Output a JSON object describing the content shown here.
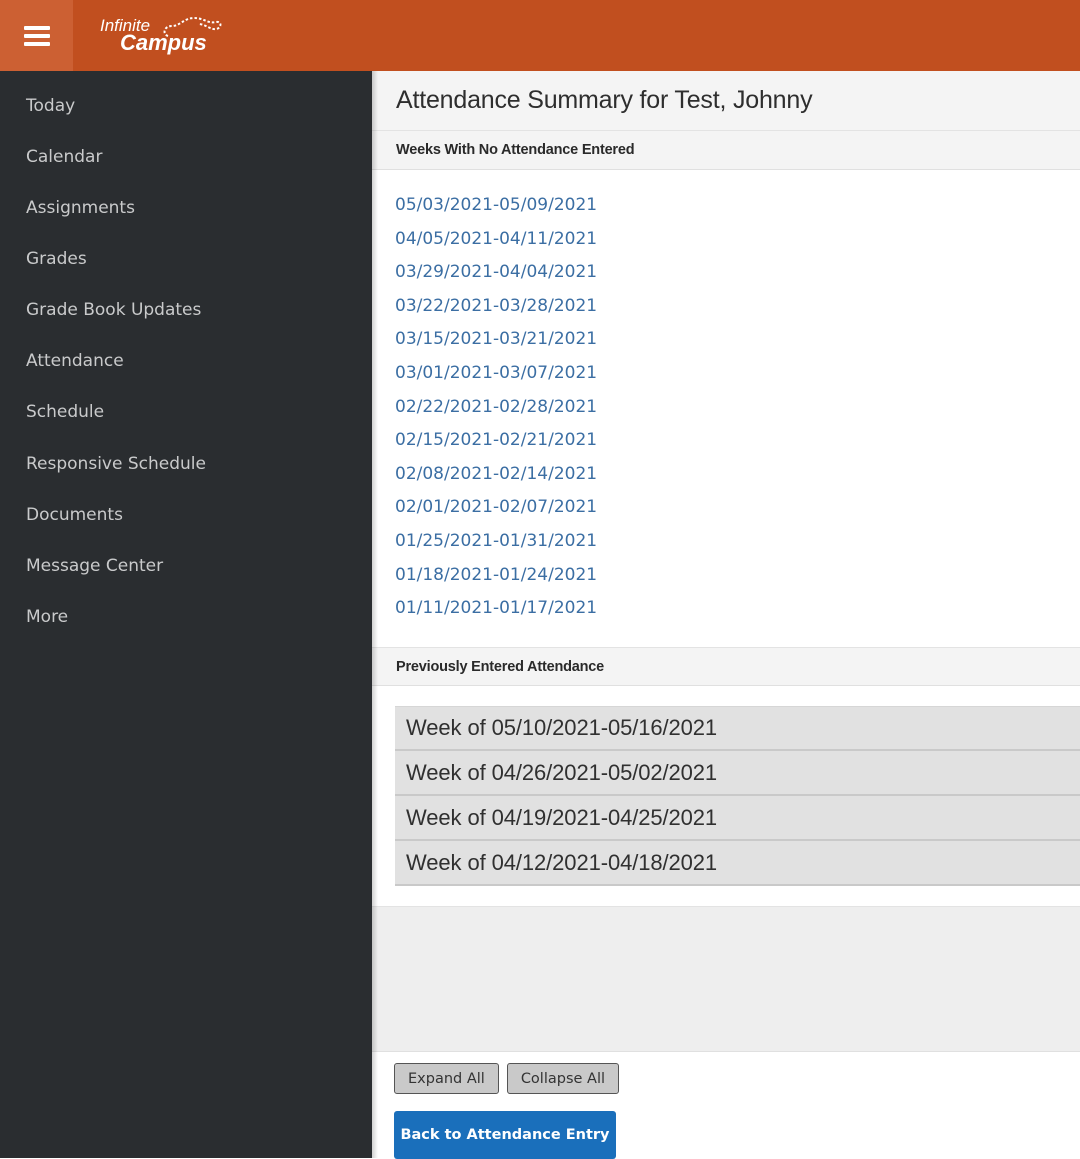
{
  "header": {
    "menu_icon": "hamburger-menu-icon",
    "logo_line1": "Infinite",
    "logo_line2": "Campus",
    "brand_color": "#c14f1f"
  },
  "sidebar": {
    "items": [
      {
        "label": "Today"
      },
      {
        "label": "Calendar"
      },
      {
        "label": "Assignments"
      },
      {
        "label": "Grades"
      },
      {
        "label": "Grade Book Updates"
      },
      {
        "label": "Attendance"
      },
      {
        "label": "Schedule"
      },
      {
        "label": "Responsive Schedule"
      },
      {
        "label": "Documents"
      },
      {
        "label": "Message Center"
      },
      {
        "label": "More"
      }
    ]
  },
  "main": {
    "title": "Attendance Summary for Test, Johnny",
    "no_attendance": {
      "heading": "Weeks With No Attendance Entered",
      "weeks": [
        "05/03/2021-05/09/2021",
        "04/05/2021-04/11/2021",
        "03/29/2021-04/04/2021",
        "03/22/2021-03/28/2021",
        "03/15/2021-03/21/2021",
        "03/01/2021-03/07/2021",
        "02/22/2021-02/28/2021",
        "02/15/2021-02/21/2021",
        "02/08/2021-02/14/2021",
        "02/01/2021-02/07/2021",
        "01/25/2021-01/31/2021",
        "01/18/2021-01/24/2021",
        "01/11/2021-01/17/2021"
      ]
    },
    "previous": {
      "heading": "Previously Entered Attendance",
      "weeks": [
        "Week of 05/10/2021-05/16/2021",
        "Week of 04/26/2021-05/02/2021",
        "Week of 04/19/2021-04/25/2021",
        "Week of 04/12/2021-04/18/2021"
      ]
    },
    "buttons": {
      "expand_all": "Expand All",
      "collapse_all": "Collapse All",
      "back": "Back to Attendance Entry"
    },
    "link_color": "#3b6ea3",
    "primary_button_color": "#1a6fbb"
  }
}
